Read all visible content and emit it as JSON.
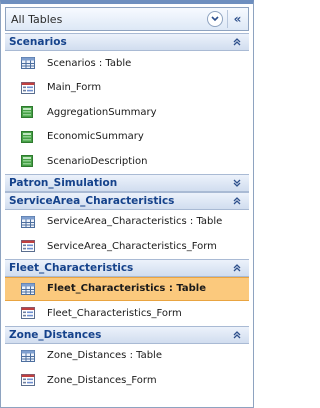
{
  "nav_pane": {
    "title": "All Tables",
    "menu_icon": "chevron-down-circle-icon",
    "shutter_icon": "double-chevron-left-icon",
    "shutter_glyph": "«"
  },
  "groups": [
    {
      "label": "Scenarios",
      "expanded": true,
      "items": [
        {
          "label": "Scenarios : Table",
          "type": "table"
        },
        {
          "label": "Main_Form",
          "type": "form"
        },
        {
          "label": "AggregationSummary",
          "type": "query"
        },
        {
          "label": "EconomicSummary",
          "type": "query"
        },
        {
          "label": "ScenarioDescription",
          "type": "query"
        }
      ]
    },
    {
      "label": "Patron_Simulation",
      "expanded": false,
      "items": []
    },
    {
      "label": "ServiceArea_Characteristics",
      "expanded": true,
      "items": [
        {
          "label": "ServiceArea_Characteristics : Table",
          "type": "table"
        },
        {
          "label": "ServiceArea_Characteristics_Form",
          "type": "form"
        }
      ]
    },
    {
      "label": "Fleet_Characteristics",
      "expanded": true,
      "items": [
        {
          "label": "Fleet_Characteristics : Table",
          "type": "table",
          "selected": true
        },
        {
          "label": "Fleet_Characteristics_Form",
          "type": "form"
        }
      ]
    },
    {
      "label": "Zone_Distances",
      "expanded": true,
      "items": [
        {
          "label": "Zone_Distances : Table",
          "type": "table"
        },
        {
          "label": "Zone_Distances_Form",
          "type": "form"
        }
      ]
    }
  ],
  "colors": {
    "group_text": "#15428b",
    "selected_bg": "#fbc97d",
    "pane_border": "#8ea3c0"
  }
}
